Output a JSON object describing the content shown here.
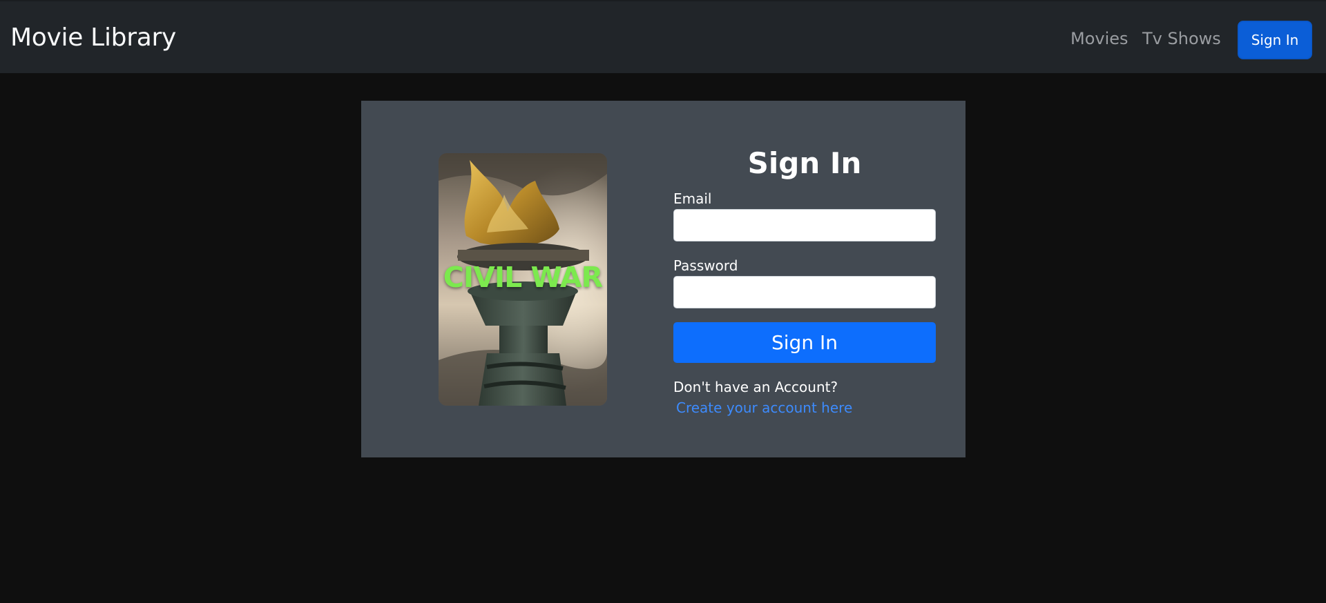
{
  "header": {
    "brand": "Movie Library",
    "nav": {
      "movies": "Movies",
      "tv_shows": "Tv Shows",
      "sign_in": "Sign In"
    }
  },
  "poster": {
    "title": "CIVIL WAR",
    "image_subject": "statue-of-liberty-torch-image"
  },
  "form": {
    "title": "Sign In",
    "email_label": "Email",
    "email_value": "",
    "password_label": "Password",
    "password_value": "",
    "submit_label": "Sign In",
    "no_account_text": "Don't have an Account?",
    "create_account_link": "Create your account here"
  },
  "colors": {
    "page_background": "#0f0f0f",
    "navbar_background": "#212529",
    "card_background": "#434a52",
    "primary_button": "#0d6efd",
    "link": "#3d8bfd",
    "poster_title": "#7ce94e"
  }
}
